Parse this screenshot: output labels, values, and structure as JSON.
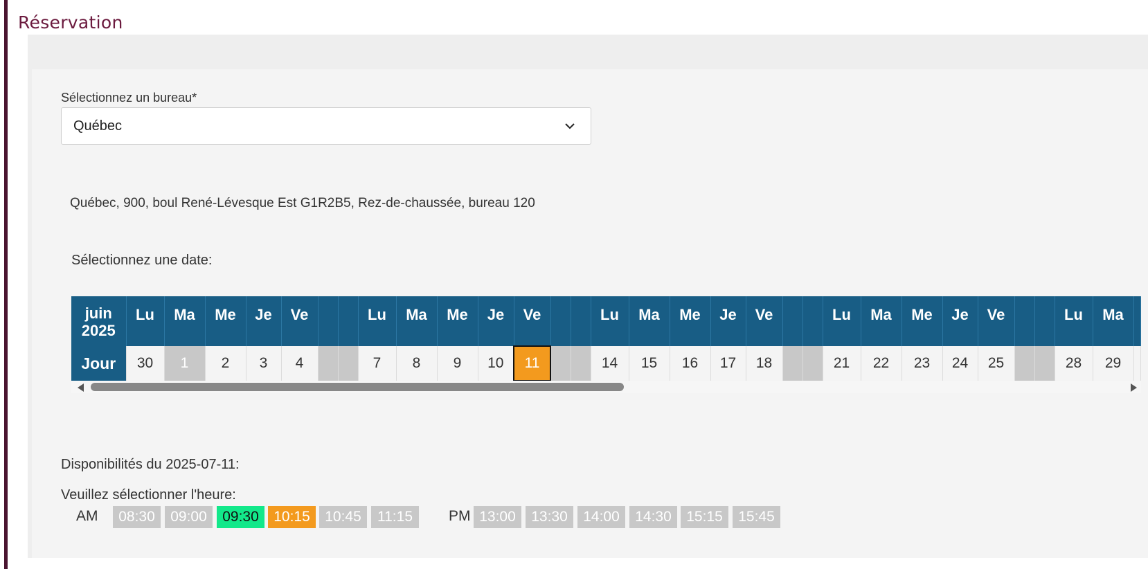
{
  "page": {
    "title": "Réservation"
  },
  "office": {
    "label": "Sélectionnez un bureau*",
    "selected": "Québec",
    "address": "Québec, 900, boul René-Lévesque Est G1R2B5, Rez-de-chaussée, bureau 120"
  },
  "calendar": {
    "label": "Sélectionnez une date:",
    "month_line1": "juin",
    "month_line2": "2025",
    "row_label": "Jour",
    "headers": [
      "Lu",
      "Ma",
      "Me",
      "Je",
      "Ve",
      "",
      "",
      "Lu",
      "Ma",
      "Me",
      "Je",
      "Ve",
      "",
      "",
      "Lu",
      "Ma",
      "Me",
      "Je",
      "Ve",
      "",
      "",
      "Lu",
      "Ma",
      "Me",
      "Je",
      "Ve",
      "",
      "",
      "Lu",
      "Ma",
      ""
    ],
    "days": [
      "30",
      "1",
      "2",
      "3",
      "4",
      "",
      "",
      "7",
      "8",
      "9",
      "10",
      "11",
      "",
      "",
      "14",
      "15",
      "16",
      "17",
      "18",
      "",
      "",
      "21",
      "22",
      "23",
      "24",
      "25",
      "",
      "",
      "28",
      "29",
      ""
    ],
    "day_states": [
      "normal",
      "off",
      "normal",
      "normal",
      "normal",
      "weekend",
      "weekend",
      "normal",
      "normal",
      "normal",
      "normal",
      "selected",
      "weekend",
      "weekend",
      "normal",
      "normal",
      "normal",
      "normal",
      "normal",
      "weekend",
      "weekend",
      "normal",
      "normal",
      "normal",
      "normal",
      "normal",
      "weekend",
      "weekend",
      "normal",
      "normal",
      "normal"
    ]
  },
  "availability": {
    "title": "Disponibilités du 2025-07-11:",
    "prompt": "Veuillez sélectionner l'heure:",
    "am_label": "AM",
    "pm_label": "PM",
    "am_slots": [
      {
        "time": "08:30",
        "state": "unavailable"
      },
      {
        "time": "09:00",
        "state": "unavailable"
      },
      {
        "time": "09:30",
        "state": "available"
      },
      {
        "time": "10:15",
        "state": "selected"
      },
      {
        "time": "10:45",
        "state": "unavailable"
      },
      {
        "time": "11:15",
        "state": "unavailable"
      }
    ],
    "pm_slots": [
      {
        "time": "13:00",
        "state": "unavailable"
      },
      {
        "time": "13:30",
        "state": "unavailable"
      },
      {
        "time": "14:00",
        "state": "unavailable"
      },
      {
        "time": "14:30",
        "state": "unavailable"
      },
      {
        "time": "15:15",
        "state": "unavailable"
      },
      {
        "time": "15:45",
        "state": "unavailable"
      }
    ]
  },
  "colors": {
    "brand": "#6b1a3e",
    "calendar_header": "#185d85",
    "selected": "#f39a1e",
    "available": "#12e88a",
    "unavailable": "#c8c8c8"
  }
}
